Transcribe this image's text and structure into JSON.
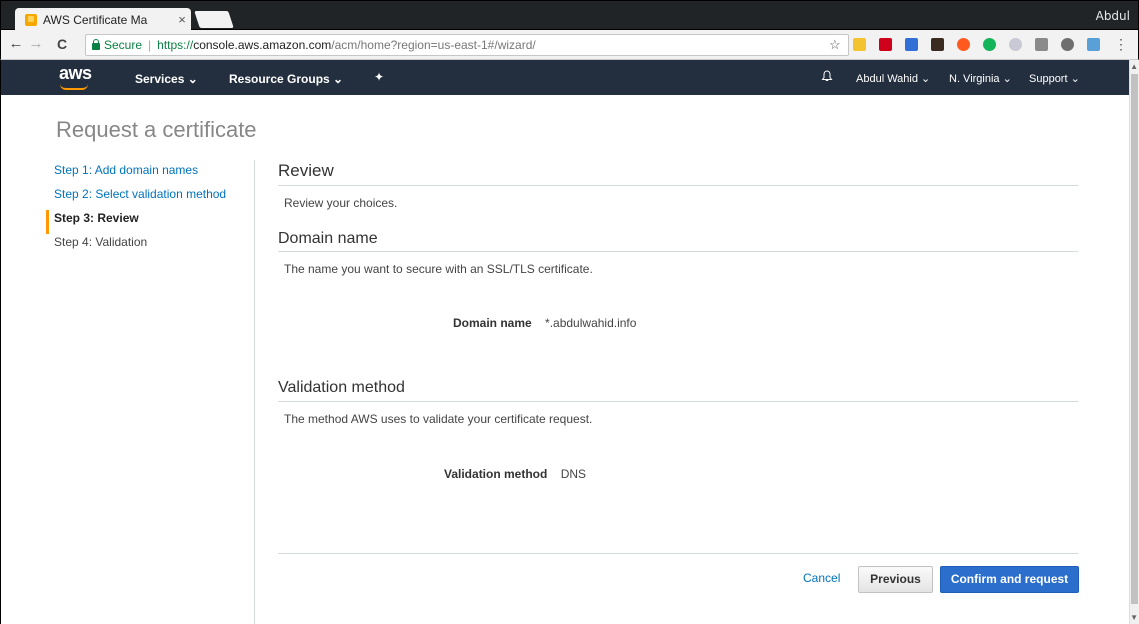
{
  "browser": {
    "tab_title": "AWS Certificate Ma",
    "tab_close": "×",
    "profile": "Abdul",
    "back": "←",
    "forward": "→",
    "reload": "C",
    "secure_label": "Secure",
    "url_scheme": "https://",
    "url_host": "console.aws.amazon.com",
    "url_path": "/acm/home?region=us-east-1#/wizard/",
    "bookmark_star": "☆",
    "menu": "⋮"
  },
  "awsnav": {
    "logo": "aws",
    "services": "Services ⌄",
    "resource_groups": "Resource Groups ⌄",
    "pin": "✦",
    "user": "Abdul Wahid ⌄",
    "region": "N. Virginia ⌄",
    "support": "Support ⌄"
  },
  "page": {
    "title": "Request a certificate"
  },
  "steps": [
    {
      "label": "Step 1: Add domain names",
      "state": "link"
    },
    {
      "label": "Step 2: Select validation method",
      "state": "link"
    },
    {
      "label": "Step 3: Review",
      "state": "active"
    },
    {
      "label": "Step 4: Validation",
      "state": "inactive"
    }
  ],
  "review": {
    "heading": "Review",
    "description": "Review your choices."
  },
  "domain": {
    "heading": "Domain name",
    "description": "The name you want to secure with an SSL/TLS certificate.",
    "key": "Domain name",
    "value": "*.abdulwahid.info"
  },
  "validation": {
    "heading": "Validation method",
    "description": "The method AWS uses to validate your certificate request.",
    "key": "Validation method",
    "value": "DNS"
  },
  "actions": {
    "cancel": "Cancel",
    "previous": "Previous",
    "confirm": "Confirm and request"
  },
  "colors": {
    "aws_nav_bg": "#232f3e",
    "accent_orange": "#ff9900",
    "link_blue": "#0073bb",
    "primary_button": "#2b6ecb"
  }
}
